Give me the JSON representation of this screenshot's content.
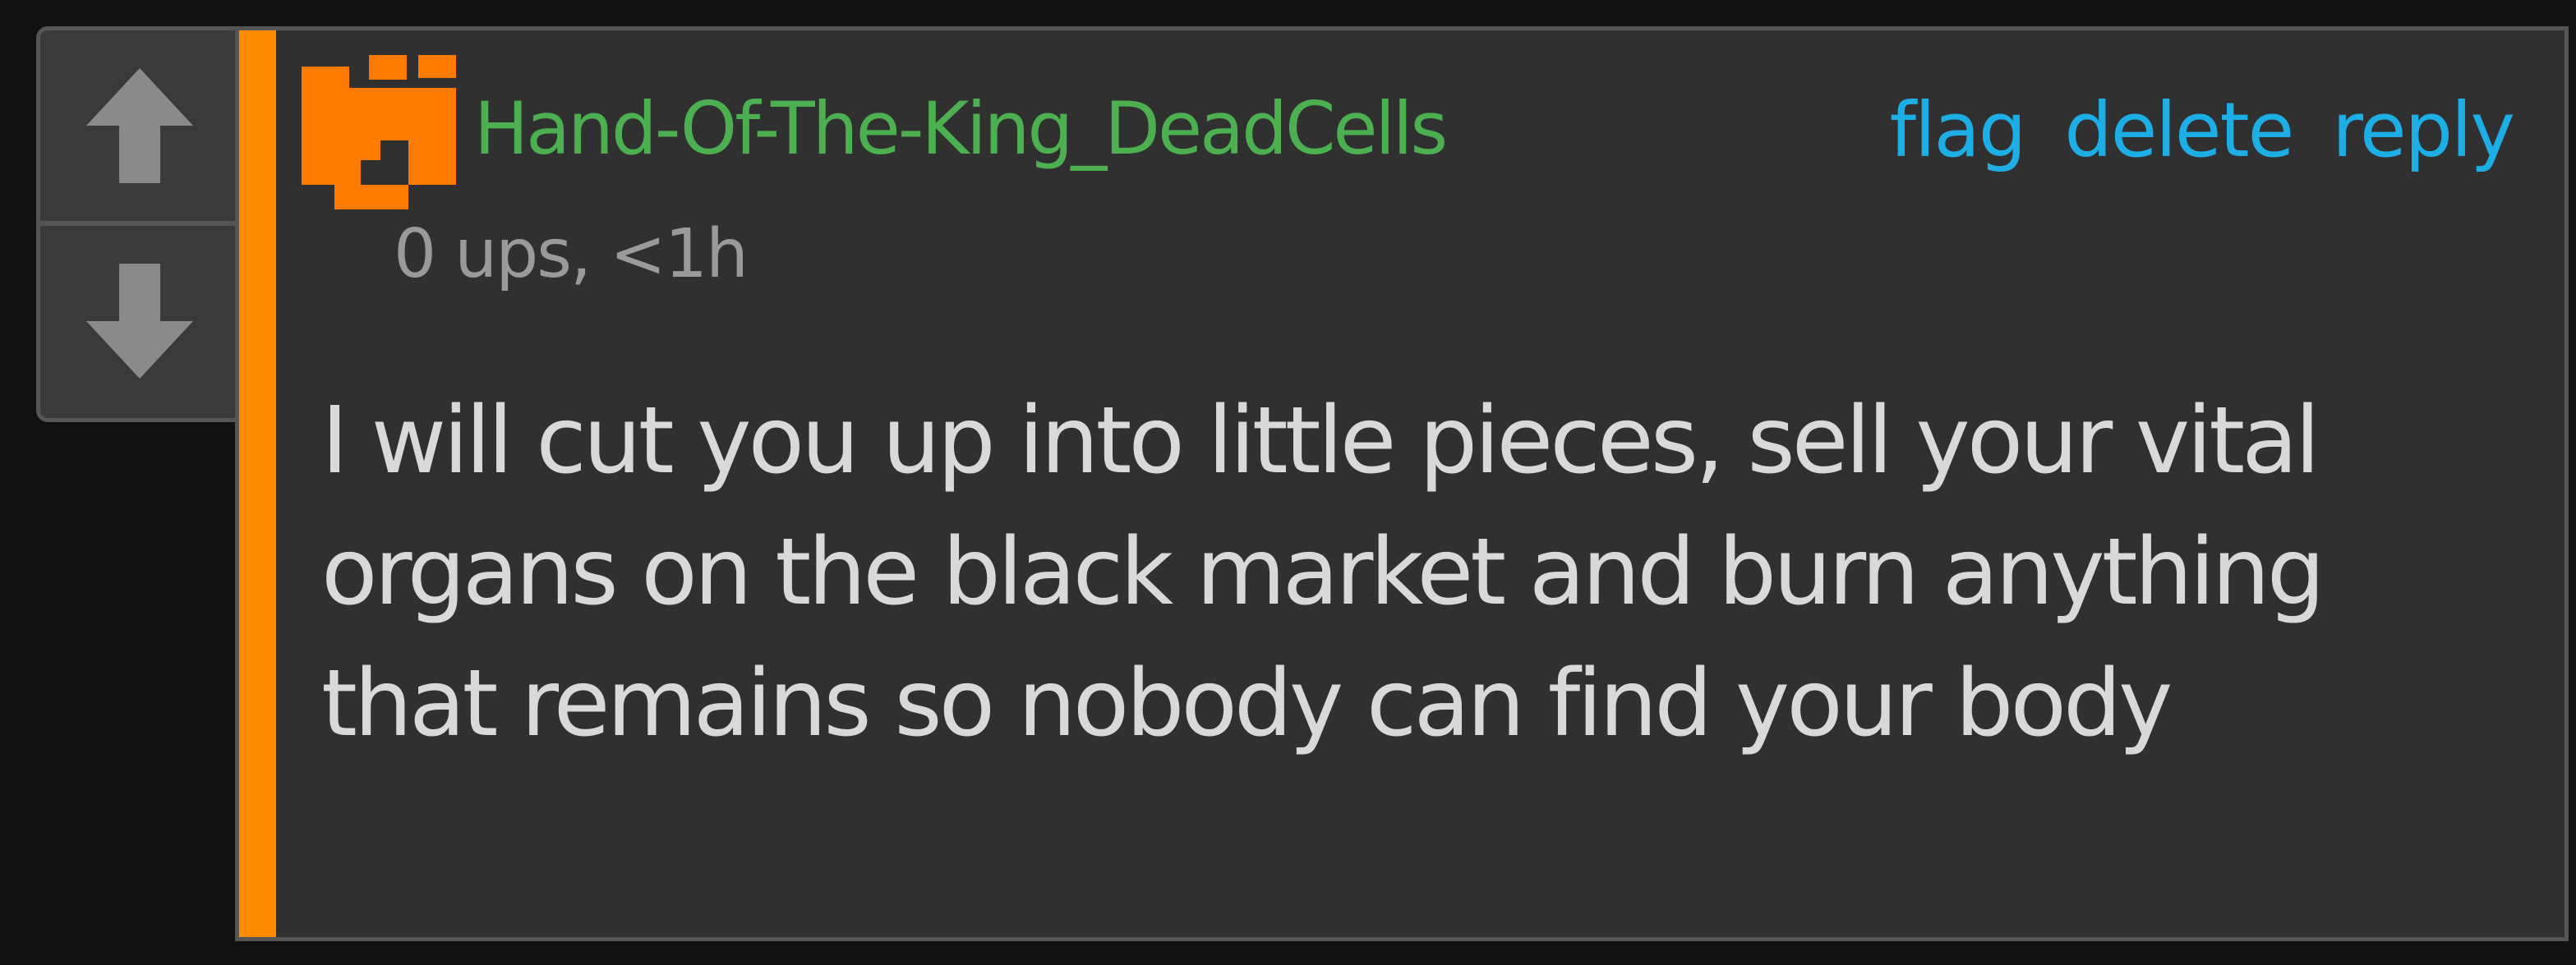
{
  "comment": {
    "username": "Hand-Of-The-King_DeadCells",
    "meta": "0 ups, <1h",
    "body": "I will cut you up into little pieces, sell your vital organs on the black market and burn anything that remains so nobody can find your body",
    "actions": {
      "flag": "flag",
      "delete": "delete",
      "reply": "reply"
    }
  },
  "vote": {
    "up_icon": "arrow-up-icon",
    "down_icon": "arrow-down-icon"
  },
  "colors": {
    "background": "#111111",
    "card": "#303030",
    "accent": "#ff8c00",
    "username": "#4caf50",
    "link": "#1eaee6",
    "meta": "#9a9a9a",
    "body": "#d9d9d9",
    "avatar": "#ff7a00"
  }
}
